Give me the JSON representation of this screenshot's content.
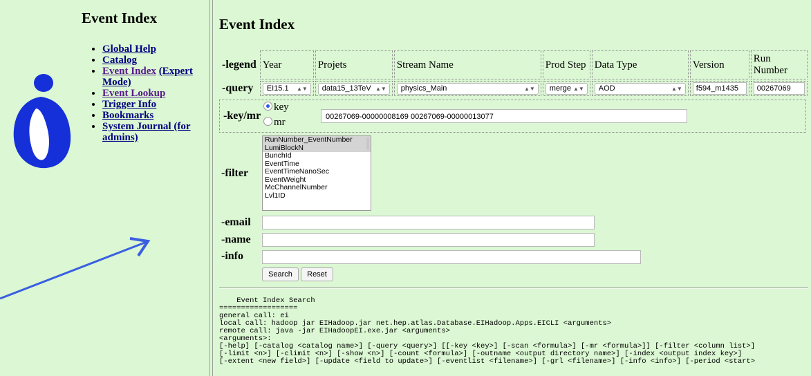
{
  "sidebar": {
    "title": "Event Index",
    "nav": [
      {
        "label": "Global Help"
      },
      {
        "label": "Catalog"
      },
      {
        "label": "Event Index",
        "extra": "(Expert Mode)"
      },
      {
        "label": "Event Lookup"
      },
      {
        "label": "Trigger Info"
      },
      {
        "label": "Bookmarks"
      },
      {
        "label": "System Journal (for admins)"
      }
    ]
  },
  "main": {
    "title": "Event Index",
    "legend_label": "-legend",
    "query_label": "-query",
    "columns": [
      "Year",
      "Projets",
      "Stream Name",
      "Prod Step",
      "Data Type",
      "Version",
      "Run Number"
    ],
    "query": {
      "year": "EI15.1",
      "project": "data15_13TeV",
      "stream": "physics_Main",
      "prod_step": "merge",
      "data_type": "AOD",
      "version": "f594_m1435",
      "run_number": "00267069"
    },
    "keymr": {
      "label": "-key/mr",
      "option_key": "key",
      "option_mr": "mr",
      "selected": "key",
      "value": "00267069-00000008169 00267069-00000013077"
    },
    "filter": {
      "label": "-filter",
      "options": [
        "RunNumber_EventNumber",
        "LumiBlockN",
        "BunchId",
        "EventTime",
        "EventTimeNanoSec",
        "EventWeight",
        "McChannelNumber",
        "Lvl1ID"
      ],
      "selected": [
        "RunNumber_EventNumber",
        "LumiBlockN"
      ]
    },
    "email_label": "-email",
    "name_label": "-name",
    "info_label": "-info",
    "search_button": "Search",
    "reset_button": "Reset",
    "help_text": "    Event Index Search\n==================\ngeneral call: ei\nlocal call: hadoop jar EIHadoop.jar net.hep.atlas.Database.EIHadoop.Apps.EICLI <arguments>\nremote call: java -jar EIHadoopEI.exe.jar <arguments>\n<arguments>:\n[-help] [-catalog <catalog name>] [-query <query>] [[-key <key>] [-scan <formula>] [-mr <formula>]] [-filter <column list>]\n[-limit <n>] [-climit <n>] [-show <n>] [-count <formula>] [-outname <output directory name>] [-index <output index key>]\n[-extent <new field>] [-update <field to update>] [-eventlist <filename>] [-grl <filename>] [-info <info>] [-period <start>"
  },
  "colors": {
    "background": "#dbf7d3",
    "link": "#000080",
    "link_visited": "#551a8b",
    "logo_blue": "#1530d8",
    "arrow_blue": "#3a5fe0"
  }
}
